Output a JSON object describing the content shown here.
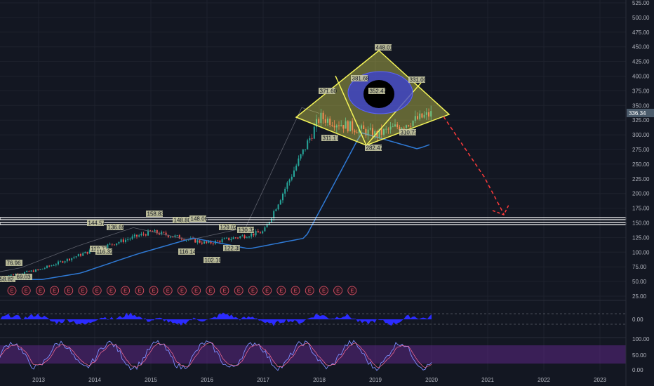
{
  "price_axis": {
    "labels": [
      "525.00",
      "500.00",
      "475.00",
      "450.00",
      "425.00",
      "400.00",
      "375.00",
      "350.00",
      "325.00",
      "300.00",
      "275.00",
      "250.00",
      "225.00",
      "200.00",
      "175.00",
      "150.00",
      "125.00",
      "100.00",
      "75.00",
      "50.00",
      "25.00"
    ],
    "current_price": "336.34"
  },
  "time_axis": {
    "labels": [
      "2013",
      "2014",
      "2015",
      "2016",
      "2017",
      "2018",
      "2019",
      "2020",
      "2021",
      "2022",
      "2023"
    ]
  },
  "osc1_axis": {
    "labels": [
      "0.00"
    ]
  },
  "osc2_axis": {
    "labels": [
      "100.00",
      "50.00",
      "0.00"
    ]
  },
  "earnings_marker": "E",
  "price_annotations": [
    "76.96",
    "58.82",
    "69.03",
    "144.57",
    "118.77",
    "136.69",
    "116.32",
    "158.83",
    "148.80",
    "148.06",
    "116.14",
    "129.02",
    "130.32",
    "102.10",
    "122.35",
    "371.60",
    "311.17",
    "448.01",
    "381.68",
    "352.47",
    "331.00",
    "282.47",
    "310.73"
  ],
  "colors": {
    "background": "#131722",
    "up_candle": "#26a69a",
    "down_candle": "#ef5350",
    "moving_average": "#2f7ad6",
    "diamond": "#f5f559",
    "eye_ring": "#3a3fd8",
    "projection": "#ff3b3b",
    "osc1": "#2b2bff",
    "osc2_band": "#6a2a9a"
  },
  "chart_data": {
    "type": "line",
    "x": [
      "2013",
      "2014",
      "2015",
      "2016",
      "2017",
      "2018",
      "2019",
      "2020"
    ],
    "series": [
      {
        "values": [
          70,
          105,
          135,
          115,
          135,
          330,
          300,
          336.34
        ]
      }
    ],
    "xlabel": "",
    "ylabel": "",
    "ylim": [
      25,
      525
    ],
    "grid": true
  }
}
